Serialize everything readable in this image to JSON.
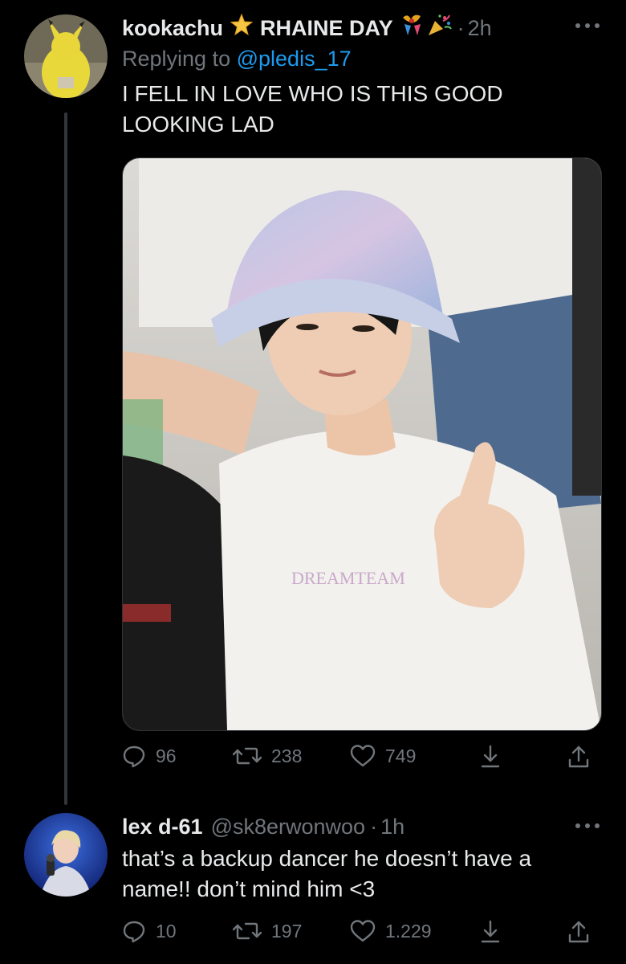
{
  "tweets": [
    {
      "display_name": "kookachu",
      "name_suffix": "RHAINE DAY",
      "separator": "·",
      "time": "2h",
      "replying_label": "Replying to",
      "replying_handle": "@pledis_17",
      "text": "I FELL IN LOVE WHO IS THIS GOOD LOOKING LAD",
      "media_caption": "DREAMTEAM",
      "replies": "96",
      "retweets": "238",
      "likes": "749"
    },
    {
      "display_name": "lex d-61",
      "handle": "@sk8erwonwoo",
      "separator": "·",
      "time": "1h",
      "text": "that’s a backup dancer he doesn’t have a name!! don’t mind him <3",
      "replies": "10",
      "retweets": "197",
      "likes": "1.229"
    }
  ],
  "icons": {
    "reply": "reply-icon",
    "retweet": "retweet-icon",
    "like": "heart-icon",
    "save": "bookmark-download-icon",
    "share": "share-icon",
    "more": "more-icon"
  },
  "colors": {
    "background": "#000000",
    "text": "#e7e9ea",
    "muted": "#71767b",
    "link": "#1d9bf0"
  }
}
